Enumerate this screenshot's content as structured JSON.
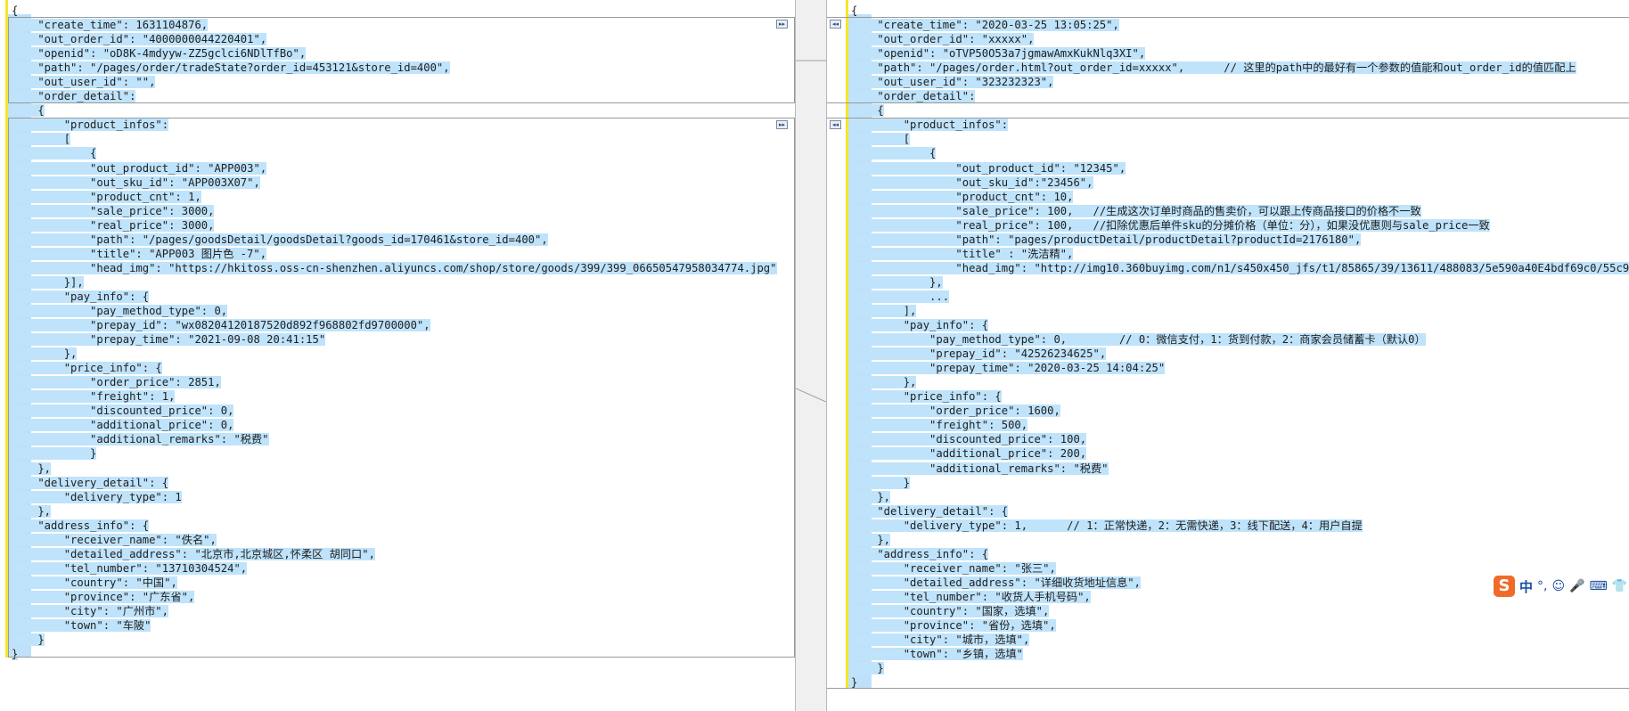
{
  "left_lines": [
    "{",
    "    \"create_time\": 1631104876,",
    "    \"out_order_id\": \"4000000044220401\",",
    "    \"openid\": \"oD8K-4mdyyw-ZZ5gclci6NDlTfBo\",",
    "    \"path\": \"/pages/order/tradeState?order_id=453121&store_id=400\",",
    "    \"out_user_id\": \"\",",
    "    \"order_detail\":",
    "    {",
    "        \"product_infos\":",
    "        [",
    "            {",
    "            \"out_product_id\": \"APP003\",",
    "            \"out_sku_id\": \"APP003X07\",",
    "            \"product_cnt\": 1,",
    "            \"sale_price\": 3000,",
    "            \"real_price\": 3000,",
    "            \"path\": \"/pages/goodsDetail/goodsDetail?goods_id=170461&store_id=400\",",
    "            \"title\": \"APP003 图片色 -7\",",
    "            \"head_img\": \"https://hkitoss.oss-cn-shenzhen.aliyuncs.com/shop/store/goods/399/399_06650547958034774.jpg\"",
    "        }],",
    "        \"pay_info\": {",
    "            \"pay_method_type\": 0,",
    "            \"prepay_id\": \"wx08204120187520d892f968802fd9700000\",",
    "            \"prepay_time\": \"2021-09-08 20:41:15\"",
    "        },",
    "        \"price_info\": {",
    "            \"order_price\": 2851,",
    "            \"freight\": 1,",
    "            \"discounted_price\": 0,",
    "            \"additional_price\": 0,",
    "            \"additional_remarks\": \"税费\"",
    "            }",
    "    },",
    "    \"delivery_detail\": {",
    "        \"delivery_type\": 1",
    "    },",
    "    \"address_info\": {",
    "        \"receiver_name\": \"佚名\",",
    "        \"detailed_address\": \"北京市,北京城区,怀柔区 胡同口\",",
    "        \"tel_number\": \"13710304524\",",
    "        \"country\": \"中国\",",
    "        \"province\": \"广东省\",",
    "        \"city\": \"广州市\",",
    "        \"town\": \"车陂\"",
    "    }",
    "}"
  ],
  "right_lines": [
    "{",
    "    \"create_time\": \"2020-03-25 13:05:25\",",
    "    \"out_order_id\": \"xxxxx\",",
    "    \"openid\": \"oTVP50O53a7jgmawAmxKukNlq3XI\",",
    "    \"path\": \"/pages/order.html?out_order_id=xxxxx\",      // 这里的path中的最好有一个参数的值能和out_order_id的值匹配上",
    "    \"out_user_id\": \"323232323\",",
    "    \"order_detail\":",
    "    {",
    "        \"product_infos\":",
    "        [",
    "            {",
    "                \"out_product_id\": \"12345\",",
    "                \"out_sku_id\":\"23456\",",
    "                \"product_cnt\": 10,",
    "                \"sale_price\": 100,   //生成这次订单时商品的售卖价，可以跟上传商品接口的价格不一致",
    "                \"real_price\": 100,   //扣除优惠后单件sku的分摊价格（单位：分），如果没优惠则与sale_price一致",
    "                \"path\": \"pages/productDetail/productDetail?productId=2176180\",",
    "                \"title\" : \"洗洁精\",",
    "                \"head_img\": \"http://img10.360buyimg.com/n1/s450x450_jfs/t1/85865/39/13611/488083/5e590a40E4bdf69c0/55c9bf645ea2b727.jpg\"",
    "            },",
    "            ...",
    "        ],",
    "        \"pay_info\": {",
    "            \"pay_method_type\": 0,        // 0：微信支付，1：货到付款，2：商家会员储蓄卡（默认0）",
    "            \"prepay_id\": \"42526234625\",",
    "            \"prepay_time\": \"2020-03-25 14:04:25\"",
    "        },",
    "        \"price_info\": {",
    "            \"order_price\": 1600,",
    "            \"freight\": 500,",
    "            \"discounted_price\": 100,",
    "            \"additional_price\": 200,",
    "            \"additional_remarks\": \"税费\"",
    "        }",
    "    },",
    "    \"delivery_detail\": {",
    "        \"delivery_type\": 1,      // 1：正常快递，2：无需快递，3：线下配送，4：用户自提",
    "    },",
    "    \"address_info\": {",
    "        \"receiver_name\": \"张三\",",
    "        \"detailed_address\": \"详细收货地址信息\",",
    "        \"tel_number\": \"收货人手机号码\",",
    "        \"country\": \"国家，选填\",",
    "        \"province\": \"省份，选填\",",
    "        \"city\": \"城市，选填\",",
    "        \"town\": \"乡镇，选填\"",
    "    }",
    "}"
  ],
  "buttons": {
    "copy_right": "▸▸",
    "copy_left": "◂◂"
  },
  "ime": {
    "logo": "S",
    "lang": "中",
    "icons": [
      "°,",
      "☺",
      "🎤",
      "⌨",
      "👕"
    ]
  },
  "colors": {
    "highlight": "#bfe3fb",
    "marker": "#f5e62a",
    "ime_brand": "#f06a2a"
  }
}
